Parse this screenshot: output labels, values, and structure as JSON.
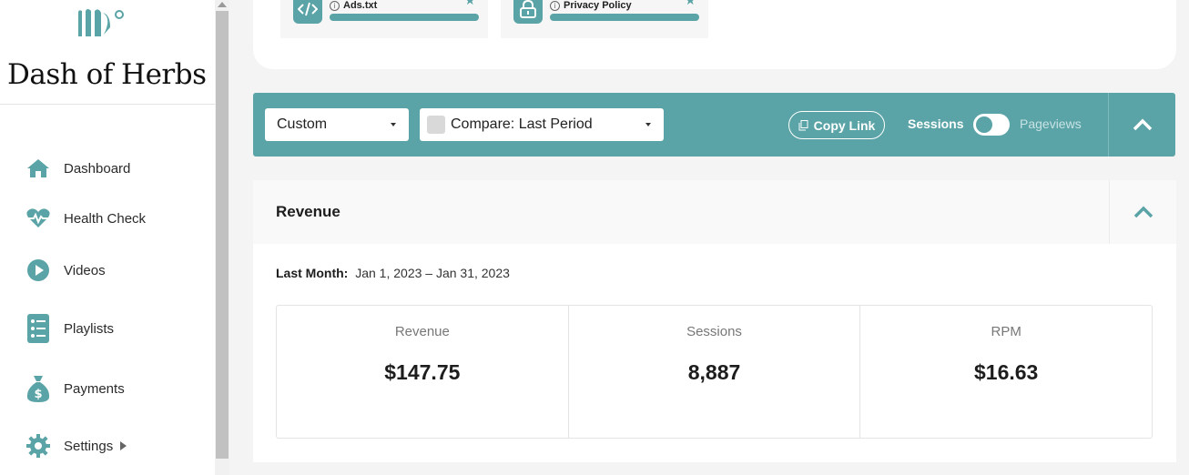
{
  "brand": {
    "name": "Dash of Herbs"
  },
  "sidebar": {
    "items": [
      {
        "label": "Dashboard",
        "icon": "home-icon"
      },
      {
        "label": "Health Check",
        "icon": "heartbeat-icon"
      },
      {
        "label": "Videos",
        "icon": "play-icon"
      },
      {
        "label": "Playlists",
        "icon": "list-icon"
      },
      {
        "label": "Payments",
        "icon": "money-bag-icon"
      },
      {
        "label": "Settings",
        "icon": "gear-icon"
      }
    ]
  },
  "tools": [
    {
      "label": "Ads.txt",
      "icon": "code-icon"
    },
    {
      "label": "Privacy Policy",
      "icon": "lock-icon"
    }
  ],
  "filters": {
    "range_select": "Custom",
    "compare_select": "Compare: Last Period",
    "copy_link": "Copy Link",
    "toggle_left": "Sessions",
    "toggle_right": "Pageviews"
  },
  "revenue": {
    "title": "Revenue",
    "period_label": "Last Month:",
    "period_range": "Jan 1, 2023 – Jan 31, 2023",
    "stats": [
      {
        "label": "Revenue",
        "value": "$147.75"
      },
      {
        "label": "Sessions",
        "value": "8,887"
      },
      {
        "label": "RPM",
        "value": "$16.63"
      }
    ]
  },
  "colors": {
    "accent": "#5aa3a6",
    "background": "#f4f4f4"
  }
}
